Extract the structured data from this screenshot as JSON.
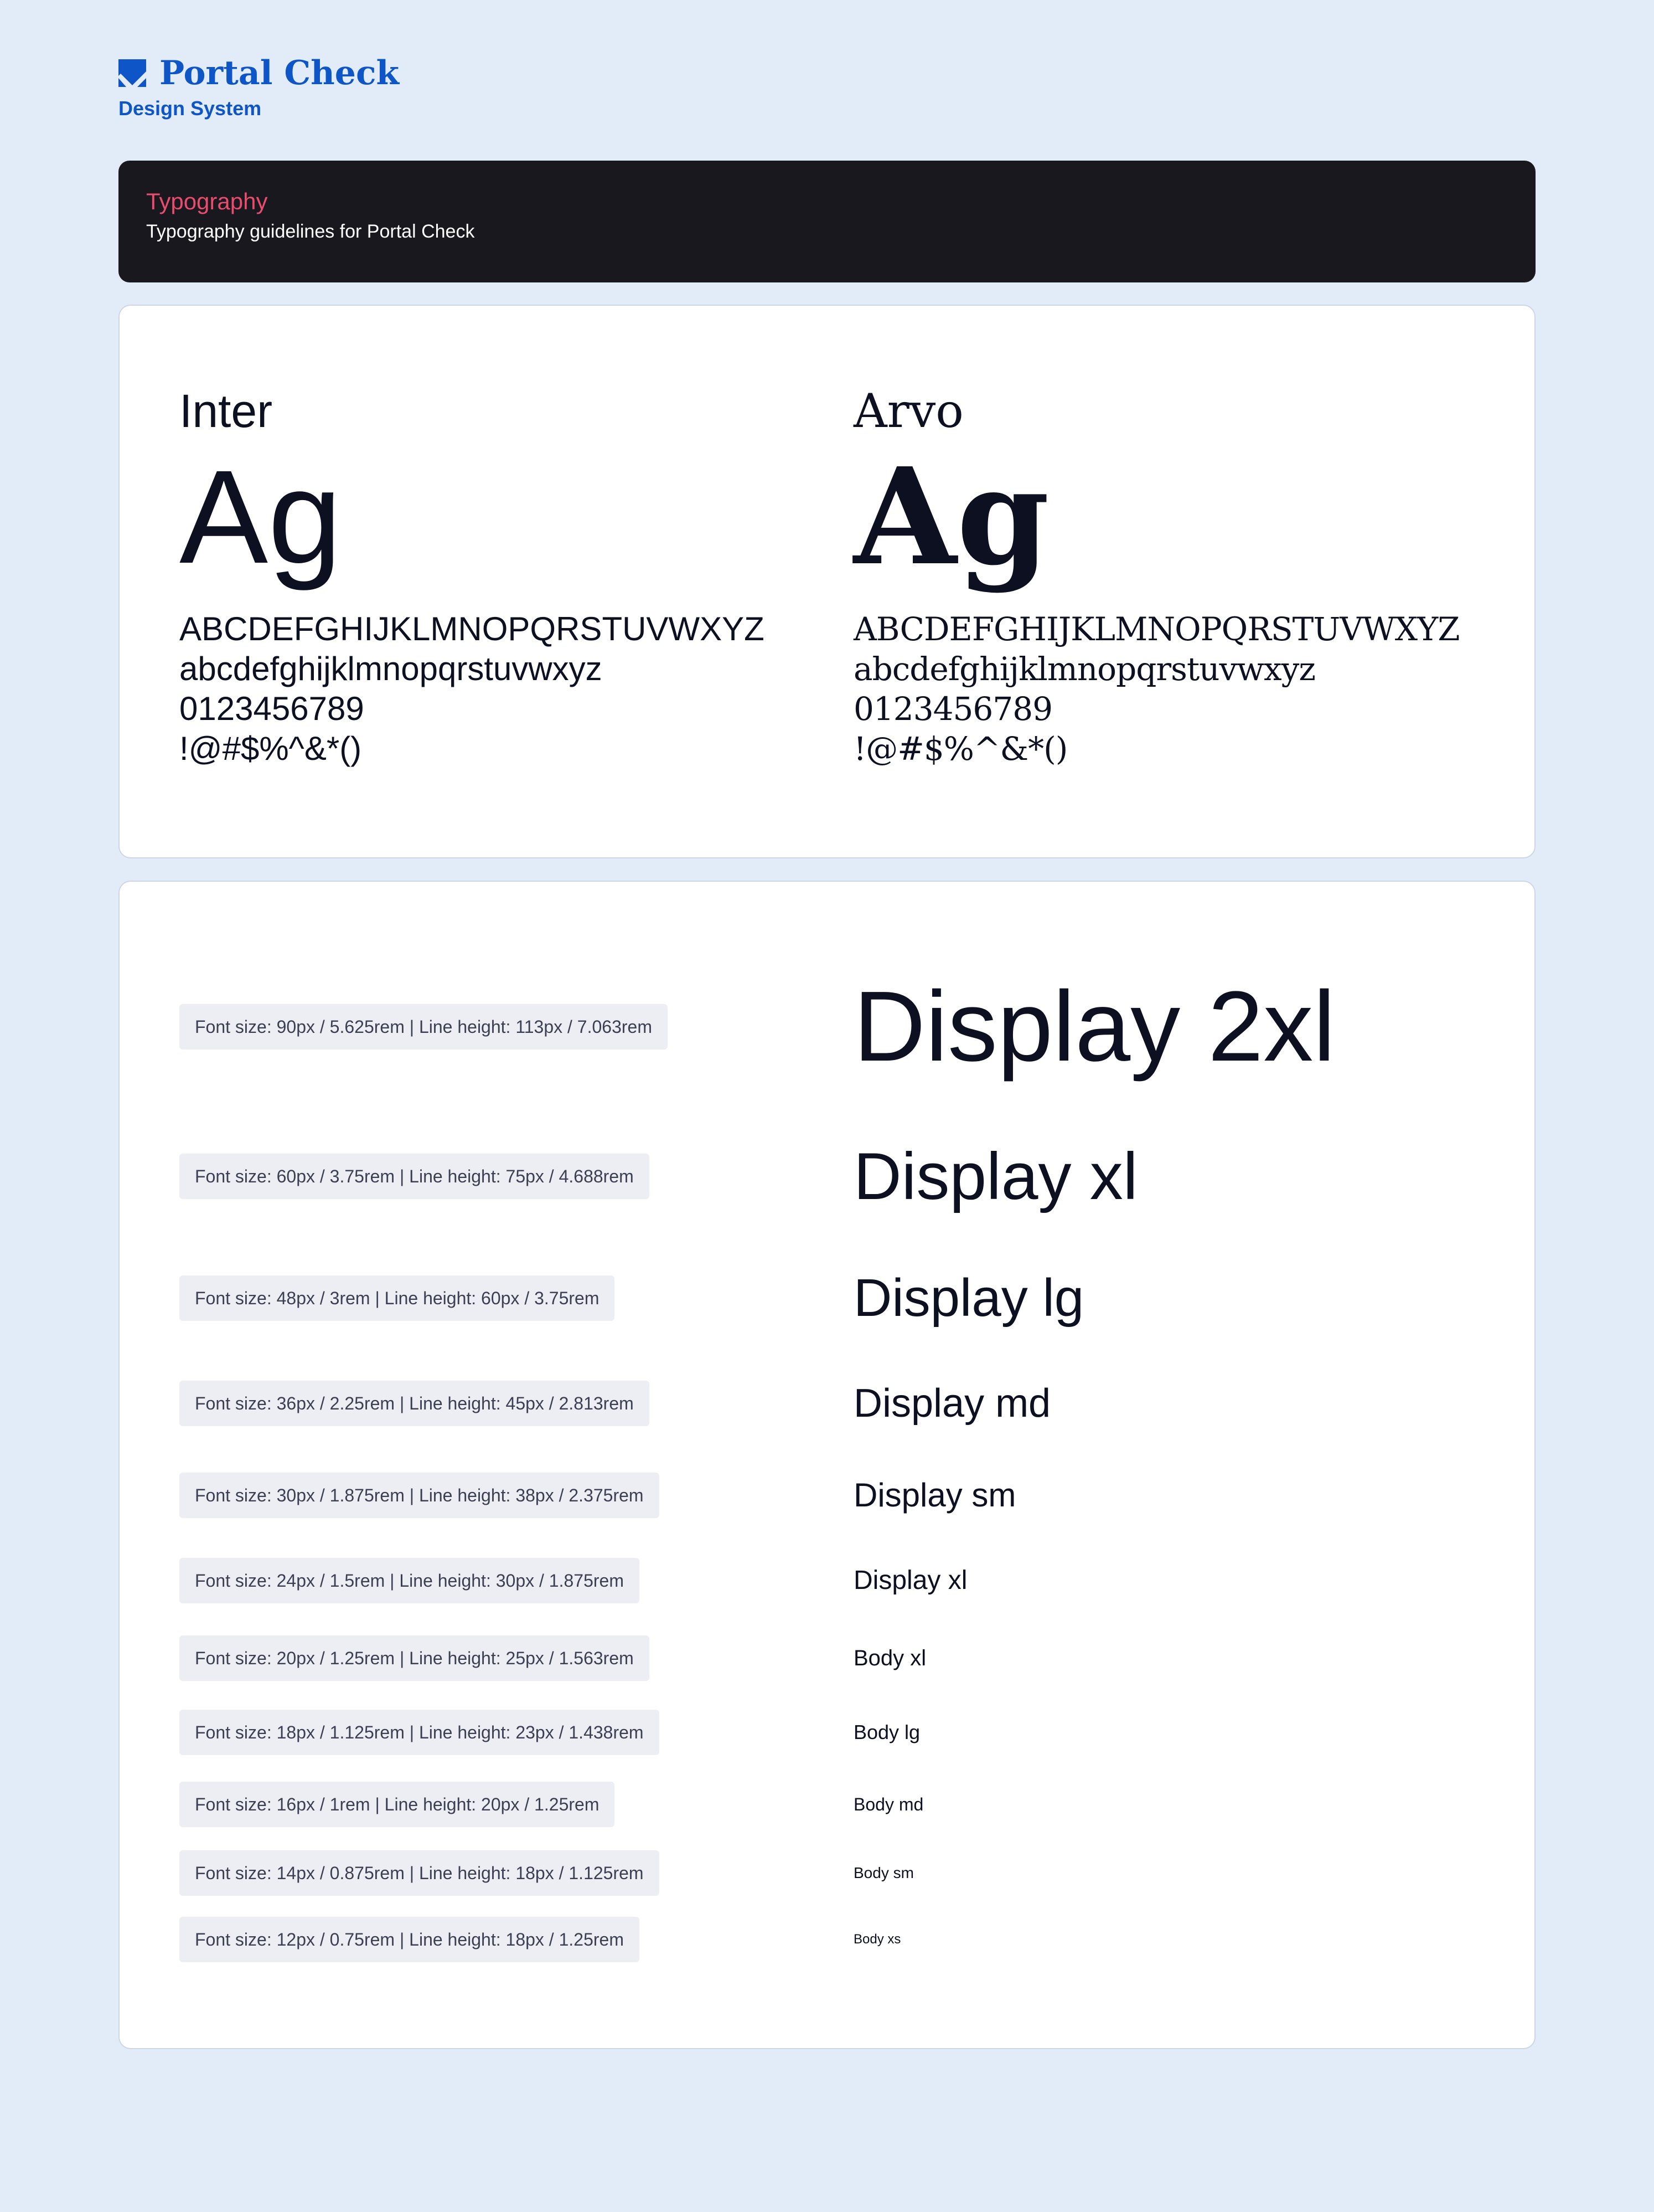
{
  "brand": {
    "name": "Portal Check",
    "subtitle": "Design System",
    "logo_icon": "check-square-icon",
    "color": "#0e56c8"
  },
  "header": {
    "title": "Typography",
    "description": "Typography guidelines for Portal Check",
    "title_color": "#ea4c6e",
    "background": "#18181e"
  },
  "fonts": [
    {
      "name": "Inter",
      "ag": "Ag",
      "uppercase": "ABCDEFGHIJKLMNOPQRSTUVWXYZ",
      "lowercase": "abcdefghijklmnopqrstuvwxyz",
      "digits": "0123456789",
      "symbols": "!@#$%^&*()"
    },
    {
      "name": "Arvo",
      "ag": "Ag",
      "uppercase": "ABCDEFGHIJKLMNOPQRSTUVWXYZ",
      "lowercase": "abcdefghijklmnopqrstuvwxyz",
      "digits": "0123456789",
      "symbols": "!@#$%^&*()"
    }
  ],
  "type_scale": [
    {
      "spec": "Font size: 90px / 5.625rem | Line height: 113px / 7.063rem",
      "label": "Display 2xl"
    },
    {
      "spec": "Font size: 60px / 3.75rem | Line height: 75px / 4.688rem",
      "label": "Display xl"
    },
    {
      "spec": "Font size: 48px / 3rem | Line height: 60px / 3.75rem",
      "label": "Display lg"
    },
    {
      "spec": "Font size: 36px / 2.25rem | Line height: 45px / 2.813rem",
      "label": "Display md"
    },
    {
      "spec": "Font size: 30px / 1.875rem | Line height: 38px / 2.375rem",
      "label": "Display sm"
    },
    {
      "spec": "Font size: 24px / 1.5rem | Line height: 30px / 1.875rem",
      "label": "Display xl"
    },
    {
      "spec": "Font size: 20px / 1.25rem | Line height: 25px / 1.563rem",
      "label": "Body xl"
    },
    {
      "spec": "Font size: 18px / 1.125rem | Line height: 23px / 1.438rem",
      "label": "Body lg"
    },
    {
      "spec": "Font size: 16px / 1rem | Line height: 20px / 1.25rem",
      "label": "Body md"
    },
    {
      "spec": "Font size: 14px / 0.875rem | Line height: 18px / 1.125rem",
      "label": "Body sm"
    },
    {
      "spec": "Font size: 12px / 0.75rem | Line height: 18px / 1.25rem",
      "label": "Body xs"
    }
  ]
}
